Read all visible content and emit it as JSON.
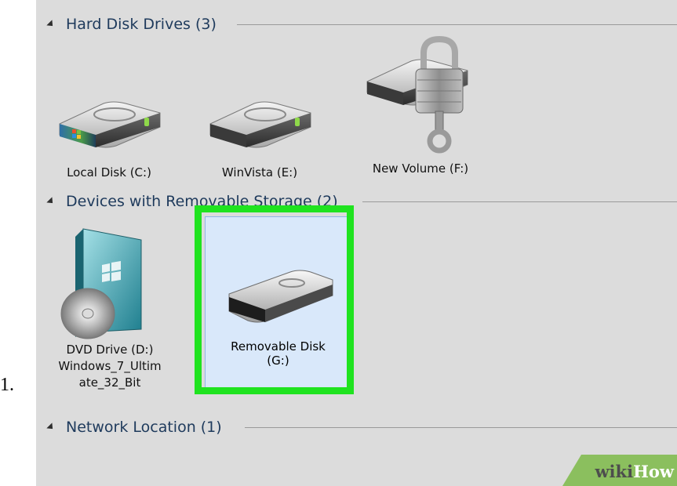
{
  "step_number": "1.",
  "groups": [
    {
      "title": "Hard Disk Drives (3)"
    },
    {
      "title": "Devices with Removable Storage (2)"
    },
    {
      "title": "Network Location (1)"
    }
  ],
  "drives": {
    "local_c": {
      "label": "Local Disk (C:)",
      "icon": "hard-drive-windows-icon"
    },
    "winvista_e": {
      "label": "WinVista (E:)",
      "icon": "hard-drive-icon"
    },
    "new_volume_f": {
      "label": "New Volume (F:)",
      "icon": "locked-drive-icon"
    },
    "dvd_d": {
      "label_lines": [
        "DVD Drive (D:)",
        "Windows_7_Ultim",
        "ate_32_Bit"
      ],
      "icon": "dvd-drive-icon"
    },
    "removable_g": {
      "label_lines": [
        "Removable Disk",
        "(G:)"
      ],
      "icon": "removable-disk-icon",
      "selected": true
    }
  },
  "highlight_color": "#1fe31f",
  "watermark": {
    "part1": "wiki",
    "part2": "How"
  }
}
